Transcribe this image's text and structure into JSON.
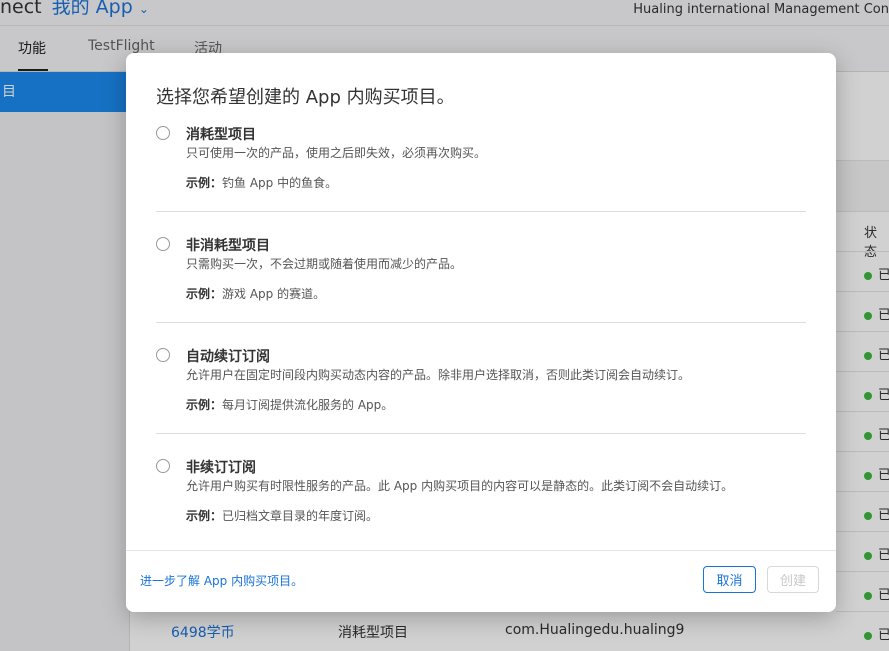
{
  "header": {
    "brand_fragment": "nect",
    "app_menu_label": "我的 App",
    "team_name": "Hualing international Management Con"
  },
  "tabs": [
    {
      "label": "功能"
    },
    {
      "label": "TestFlight"
    },
    {
      "label": "活动"
    }
  ],
  "sidebar": {
    "selected_fragment": "目"
  },
  "table": {
    "status_header": "状态",
    "status_fragment": "已",
    "last_row": {
      "name": "6498学币",
      "type": "消耗型项目",
      "product_id": "com.Hualingedu.hualing9"
    }
  },
  "modal": {
    "title": "选择您希望创建的 App 内购买项目。",
    "options": [
      {
        "title": "消耗型项目",
        "description": "只可使用一次的产品，使用之后即失效，必须再次购买。",
        "example_label": "示例：",
        "example": "钓鱼 App 中的鱼食。"
      },
      {
        "title": "非消耗型项目",
        "description": "只需购买一次，不会过期或随着使用而减少的产品。",
        "example_label": "示例：",
        "example": "游戏 App 的赛道。"
      },
      {
        "title": "自动续订订阅",
        "description": "允许用户在固定时间段内购买动态内容的产品。除非用户选择取消，否则此类订阅会自动续订。",
        "example_label": "示例：",
        "example": "每月订阅提供流化服务的 App。"
      },
      {
        "title": "非续订订阅",
        "description": "允许用户购买有时限性服务的产品。此 App 内购买项目的内容可以是静态的。此类订阅不会自动续订。",
        "example_label": "示例：",
        "example": "已归档文章目录的年度订阅。"
      }
    ],
    "learn_more_link": "进一步了解 App 内购买项目。",
    "cancel_label": "取消",
    "create_label": "创建"
  },
  "colors": {
    "accent": "#1a73d9",
    "sidebar_selected": "#1b8af0",
    "status_green": "#3cb83c"
  }
}
